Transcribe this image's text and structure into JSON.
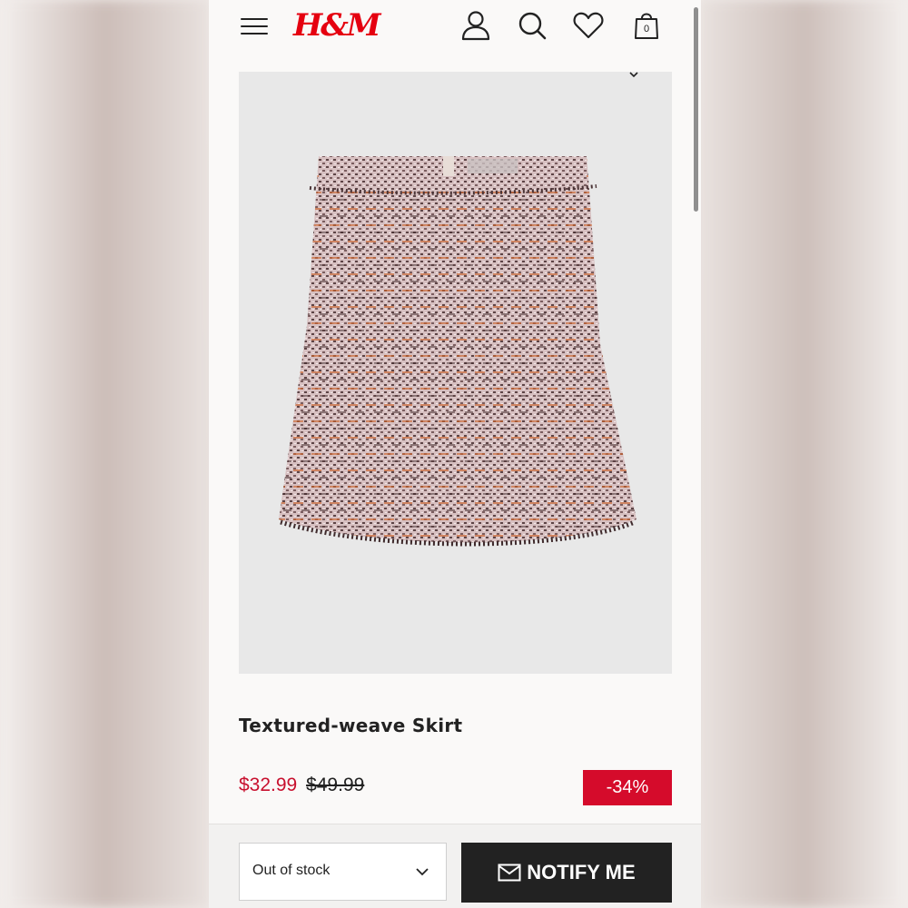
{
  "header": {
    "logo": "H&M",
    "bag_count": "0",
    "icons": [
      "menu-icon",
      "account-icon",
      "search-icon",
      "heart-icon",
      "bag-icon"
    ]
  },
  "product": {
    "title": "Textured-weave Skirt",
    "sale_price": "$32.99",
    "original_price": "$49.99",
    "discount": "-34%",
    "image_subject": "tweed-skirt"
  },
  "purchase": {
    "size_select": "Out of stock",
    "notify_label": "NOTIFY ME"
  },
  "colors": {
    "brand_red": "#e50010",
    "sale_red": "#c8102e",
    "badge_red": "#d50b2b",
    "button_dark": "#222222"
  }
}
